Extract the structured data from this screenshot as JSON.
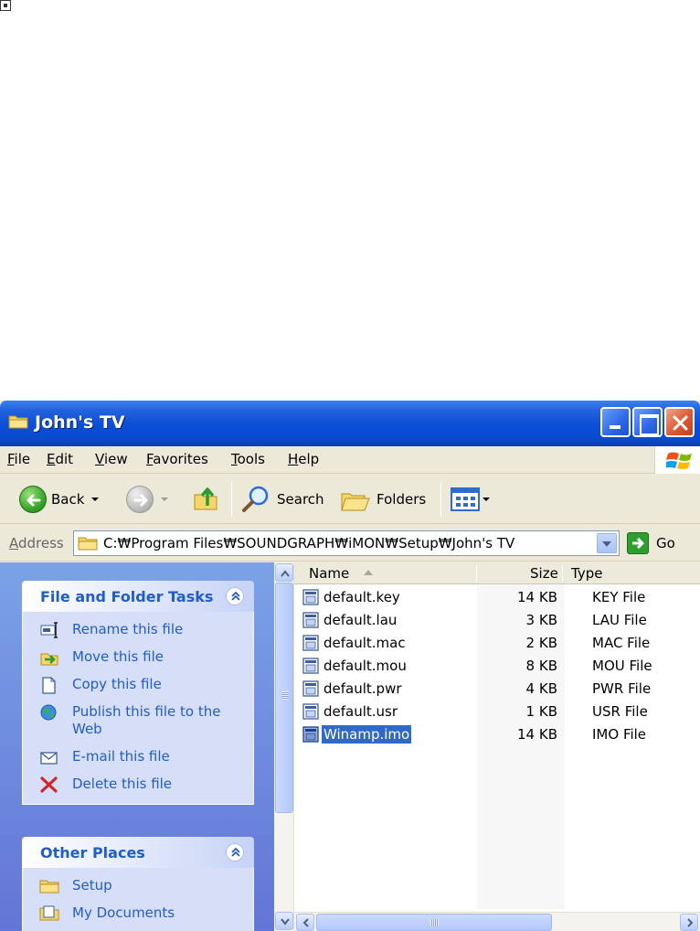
{
  "window": {
    "title": "John's TV",
    "controls": [
      "minimize",
      "maximize",
      "close"
    ]
  },
  "menubar": {
    "items": [
      "File",
      "Edit",
      "View",
      "Favorites",
      "Tools",
      "Help"
    ]
  },
  "toolbar": {
    "back_label": "Back",
    "search_label": "Search",
    "folders_label": "Folders"
  },
  "addressbar": {
    "label": "Address",
    "path": "C:₩Program Files₩SOUNDGRAPH₩iMON₩Setup₩John's TV",
    "go_label": "Go"
  },
  "tasks_panel": {
    "title": "File and Folder Tasks",
    "items": [
      {
        "label": "Rename this file",
        "icon": "rename-icon"
      },
      {
        "label": "Move this file",
        "icon": "move-icon"
      },
      {
        "label": "Copy this file",
        "icon": "copy-icon"
      },
      {
        "label": "Publish this file to the Web",
        "icon": "globe-icon"
      },
      {
        "label": "E-mail this file",
        "icon": "envelope-icon"
      },
      {
        "label": "Delete this file",
        "icon": "delete-x-icon"
      }
    ]
  },
  "places_panel": {
    "title": "Other Places",
    "items": [
      {
        "label": "Setup",
        "icon": "folder-icon"
      },
      {
        "label": "My Documents",
        "icon": "my-documents-icon"
      }
    ]
  },
  "filelist": {
    "columns": {
      "name": "Name",
      "size": "Size",
      "type": "Type"
    },
    "files": [
      {
        "name": "default.key",
        "size": "14 KB",
        "type": "KEY File",
        "selected": false
      },
      {
        "name": "default.lau",
        "size": "3 KB",
        "type": "LAU File",
        "selected": false
      },
      {
        "name": "default.mac",
        "size": "2 KB",
        "type": "MAC File",
        "selected": false
      },
      {
        "name": "default.mou",
        "size": "8 KB",
        "type": "MOU File",
        "selected": false
      },
      {
        "name": "default.pwr",
        "size": "4 KB",
        "type": "PWR File",
        "selected": false
      },
      {
        "name": "default.usr",
        "size": "1 KB",
        "type": "USR File",
        "selected": false
      },
      {
        "name": "Winamp.imo",
        "size": "14 KB",
        "type": "IMO File",
        "selected": true
      }
    ]
  },
  "colors": {
    "title_blue": "#0a4dd7",
    "task_link": "#215dc6",
    "selection": "#316ac5",
    "chrome": "#ece9d8"
  }
}
